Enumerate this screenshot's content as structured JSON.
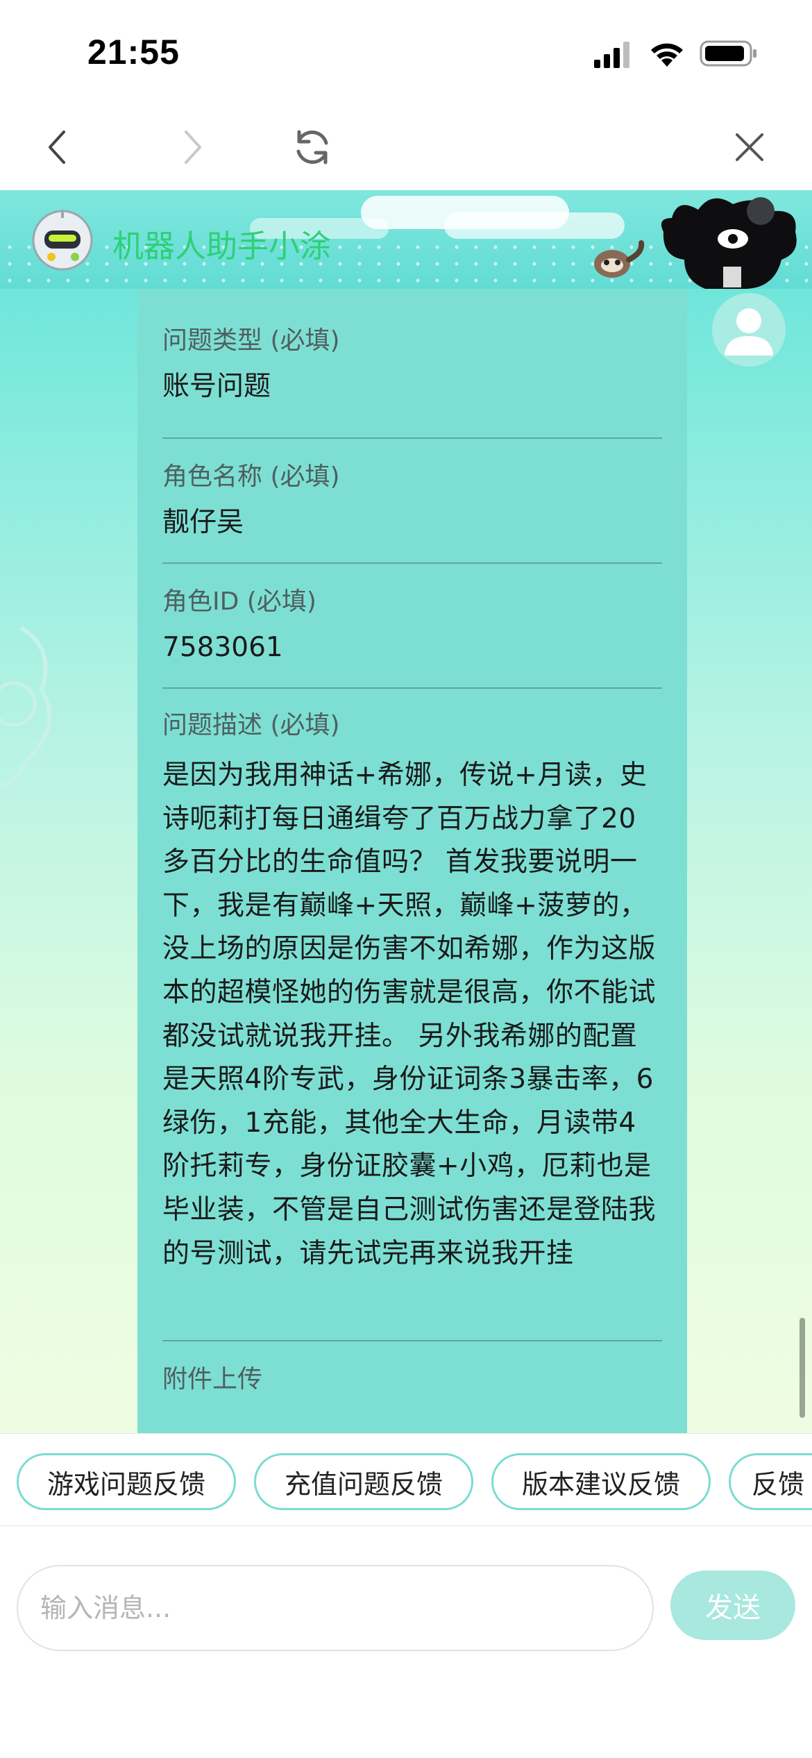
{
  "status_bar": {
    "time": "21:55"
  },
  "chat": {
    "title": "机器人助手小涂"
  },
  "form": {
    "fields": [
      {
        "label": "问题类型 (必填)",
        "value": "账号问题"
      },
      {
        "label": "角色名称 (必填)",
        "value": "靓仔吴"
      },
      {
        "label": "角色ID (必填)",
        "value": "7583061"
      },
      {
        "label": "问题描述 (必填)",
        "value": "是因为我用神话+希娜，传说+月读，史诗呃莉打每日通缉夸了百万战力拿了20多百分比的生命值吗？ 首发我要说明一下，我是有巅峰+天照，巅峰+菠萝的，没上场的原因是伤害不如希娜，作为这版本的超模怪她的伤害就是很高，你不能试都没试就说我开挂。 另外我希娜的配置是天照4阶专武，身份证词条3暴击率，6绿伤，1充能，其他全大生命，月读带4阶托莉专，身份证胶囊+小鸡，厄莉也是毕业装，不管是自己测试伤害还是登陆我的号测试，请先试完再来说我开挂"
      },
      {
        "label": "附件上传",
        "value": "--"
      }
    ]
  },
  "quick_replies": [
    "游戏问题反馈",
    "充值问题反馈",
    "版本建议反馈",
    "反馈"
  ],
  "input": {
    "placeholder": "输入消息...",
    "send_label": "发送"
  },
  "colors": {
    "accent": "#79dcd1",
    "title_green": "#2fcf78",
    "card": "#7ddfd3",
    "send_disabled": "#a8e8df"
  },
  "icons": [
    "signal-icon",
    "wifi-icon",
    "battery-icon",
    "back-icon",
    "forward-icon",
    "refresh-icon",
    "close-icon",
    "robot-avatar-icon",
    "user-avatar-icon"
  ]
}
